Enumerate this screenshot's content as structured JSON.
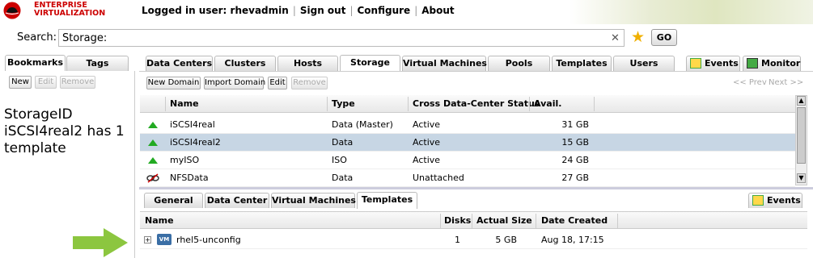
{
  "header": {
    "logo_line1": "ENTERPRISE",
    "logo_line2": "VIRTUALIZATION",
    "logged_in": "Logged in user: rhevadmin",
    "sign_out": "Sign out",
    "configure": "Configure",
    "about": "About"
  },
  "search": {
    "label": "Search:",
    "value": "Storage:",
    "go": "GO"
  },
  "left_tabs": [
    "Bookmarks",
    "Tags"
  ],
  "main_tabs": [
    "Data Centers",
    "Clusters",
    "Hosts",
    "Storage",
    "Virtual Machines",
    "Pools",
    "Templates",
    "Users"
  ],
  "right_tabs": [
    "Events",
    "Monitor"
  ],
  "left_buttons": [
    "New",
    "Edit",
    "Remove"
  ],
  "storage_buttons": [
    "New Domain",
    "Import Domain",
    "Edit",
    "Remove"
  ],
  "pager": {
    "prev": "<< Prev",
    "next": "Next >>"
  },
  "annotation": "StorageID iSCSI4real2 has 1 template",
  "storage_table": {
    "columns": [
      "Name",
      "Type",
      "Cross Data-Center Status",
      "Avail."
    ],
    "rows": [
      {
        "name": "iSCSI4real",
        "type": "Data (Master)",
        "status": "Active",
        "avail": "31 GB"
      },
      {
        "name": "iSCSI4real2",
        "type": "Data",
        "status": "Active",
        "avail": "15 GB"
      },
      {
        "name": "myISO",
        "type": "ISO",
        "status": "Active",
        "avail": "24 GB"
      },
      {
        "name": "NFSData",
        "type": "Data",
        "status": "Unattached",
        "avail": "27 GB"
      }
    ]
  },
  "sub_tabs": [
    "General",
    "Data Center",
    "Virtual Machines",
    "Templates"
  ],
  "sub_events": "Events",
  "templates_table": {
    "columns": [
      "Name",
      "Disks",
      "Actual Size",
      "Date Created"
    ],
    "rows": [
      {
        "name": "rhel5-unconfig",
        "disks": "1",
        "size": "5 GB",
        "date": "Aug 18, 17:15"
      }
    ]
  },
  "colors": {
    "brand": "#cc0000",
    "selected_row": "#c7d6e4",
    "status_up": "#22aa22",
    "arrow": "#8cc63f"
  }
}
